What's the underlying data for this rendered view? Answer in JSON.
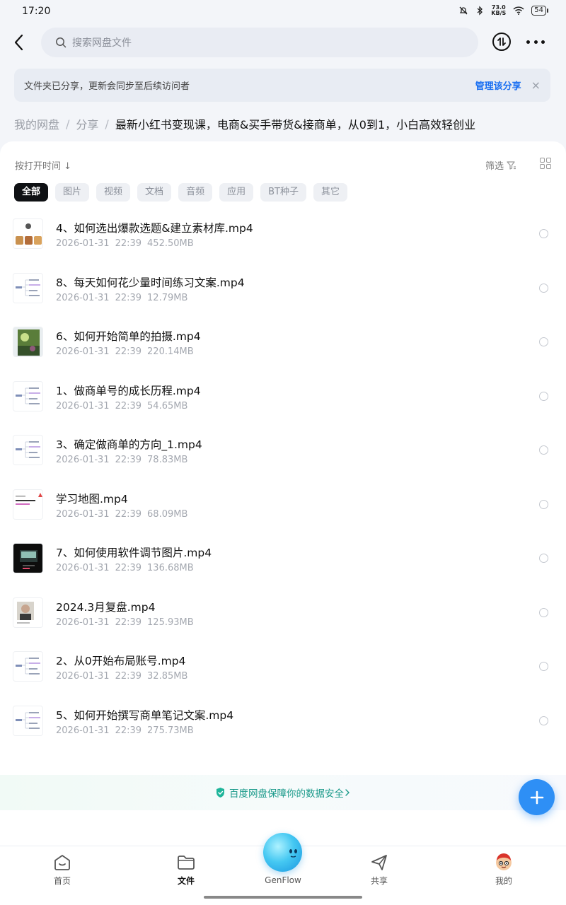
{
  "status_bar": {
    "time": "17:20",
    "net_speed_value": "73.0",
    "net_speed_unit": "KB/S",
    "battery": "54"
  },
  "header": {
    "search_placeholder": "搜索网盘文件"
  },
  "share_notice": {
    "text": "文件夹已分享，更新会同步至后续访问者",
    "manage_label": "管理该分享",
    "close_symbol": "×"
  },
  "breadcrumb": {
    "items": [
      "我的网盘",
      "分享"
    ],
    "separator": "/",
    "current": "最新小红书变现课，电商&买手带货&接商单，从0到1，小白高效轻创业"
  },
  "toolbar": {
    "sort_label": "按打开时间 ↓",
    "filter_label": "筛选"
  },
  "chips": [
    "全部",
    "图片",
    "视频",
    "文档",
    "音频",
    "应用",
    "BT种子",
    "其它"
  ],
  "files": [
    {
      "name": "4、如何选出爆款选题&建立素材库.mp4",
      "date": "2026-01-31",
      "time": "22:39",
      "size": "452.50MB",
      "thumb": "food-photos"
    },
    {
      "name": "8、每天如何花少量时间练习文案.mp4",
      "date": "2026-01-31",
      "time": "22:39",
      "size": "12.79MB",
      "thumb": "mindmap"
    },
    {
      "name": "6、如何开始简单的拍摄.mp4",
      "date": "2026-01-31",
      "time": "22:39",
      "size": "220.14MB",
      "thumb": "garden-photo"
    },
    {
      "name": "1、做商单号的成长历程.mp4",
      "date": "2026-01-31",
      "time": "22:39",
      "size": "54.65MB",
      "thumb": "mindmap"
    },
    {
      "name": "3、确定做商单的方向_1.mp4",
      "date": "2026-01-31",
      "time": "22:39",
      "size": "78.83MB",
      "thumb": "mindmap"
    },
    {
      "name": "学习地图.mp4",
      "date": "2026-01-31",
      "time": "22:39",
      "size": "68.09MB",
      "thumb": "slide"
    },
    {
      "name": "7、如何使用软件调节图片.mp4",
      "date": "2026-01-31",
      "time": "22:39",
      "size": "136.68MB",
      "thumb": "dark-phone"
    },
    {
      "name": "2024.3月复盘.mp4",
      "date": "2026-01-31",
      "time": "22:39",
      "size": "125.93MB",
      "thumb": "portrait"
    },
    {
      "name": "2、从0开始布局账号.mp4",
      "date": "2026-01-31",
      "time": "22:39",
      "size": "32.85MB",
      "thumb": "mindmap"
    },
    {
      "name": "5、如何开始撰写商单笔记文案.mp4",
      "date": "2026-01-31",
      "time": "22:39",
      "size": "275.73MB",
      "thumb": "mindmap"
    }
  ],
  "security_banner": "百度网盘保障你的数据安全",
  "bottom_nav": {
    "home": "首页",
    "files": "文件",
    "genflow": "GenFlow",
    "share": "共享",
    "mine": "我的"
  },
  "colors": {
    "accent": "#1a6ff2",
    "fab": "#2e8ff5",
    "security": "#1a9a8a",
    "chip_active_bg": "#0f1114"
  }
}
